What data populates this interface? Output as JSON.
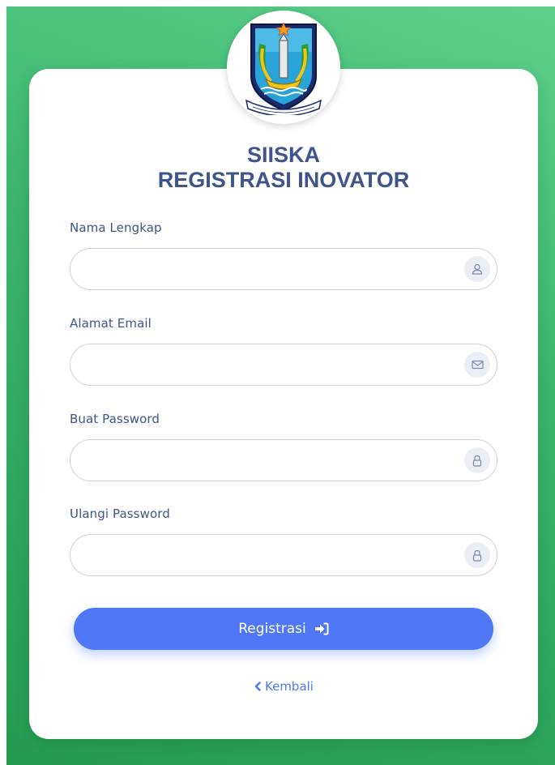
{
  "header": {
    "title_line1": "SIISKA",
    "title_line2": "REGISTRASI INOVATOR",
    "logo_icon": "east-java-crest-icon"
  },
  "form": {
    "fields": [
      {
        "label": "Nama Lengkap",
        "value": "",
        "icon": "user-icon"
      },
      {
        "label": "Alamat Email",
        "value": "",
        "icon": "envelope-icon"
      },
      {
        "label": "Buat Password",
        "value": "",
        "icon": "lock-icon"
      },
      {
        "label": "Ulangi Password",
        "value": "",
        "icon": "lock-icon"
      }
    ],
    "submit_label": "Registrasi",
    "submit_icon": "sign-in-icon",
    "back_label": "Kembali",
    "back_icon": "chevron-left-icon"
  },
  "colors": {
    "background_green": "#3ab56e",
    "title_color": "#3f548c",
    "accent_blue": "#5077f5"
  }
}
